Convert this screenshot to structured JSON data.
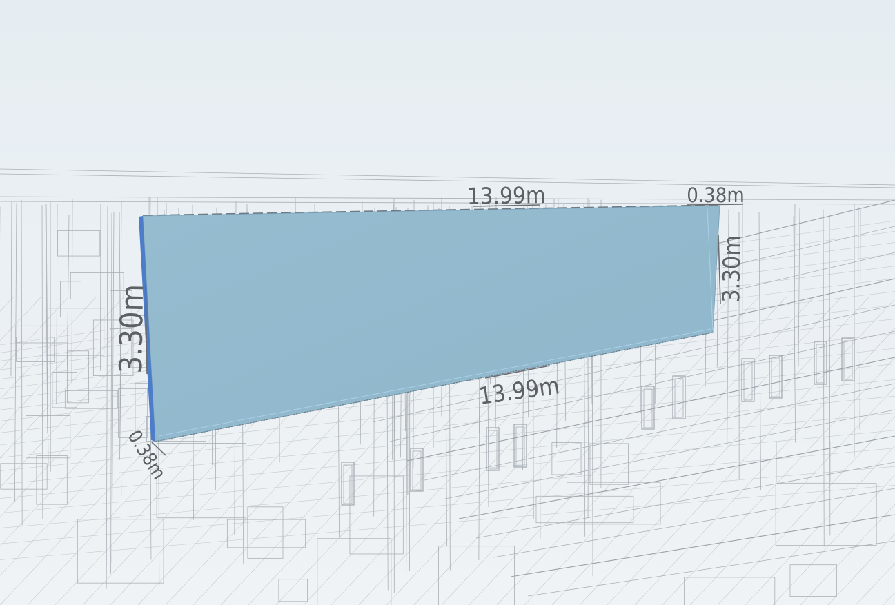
{
  "viewer": {
    "selected_element": "wall",
    "colors": {
      "background_top": "#e8eef3",
      "background_bottom": "#f1f4f6",
      "wall_face": "#93b9cd",
      "wall_edge": "#4a78c8",
      "dimension_text": "#5d6165",
      "wireframe": "#a9b0b6"
    }
  },
  "dimensions": {
    "top_length": "13.99m",
    "bottom_length": "13.99m",
    "left_height": "3.30m",
    "right_height": "3.30m",
    "top_thickness": "0.38m",
    "bottom_thickness": "0.38m"
  }
}
